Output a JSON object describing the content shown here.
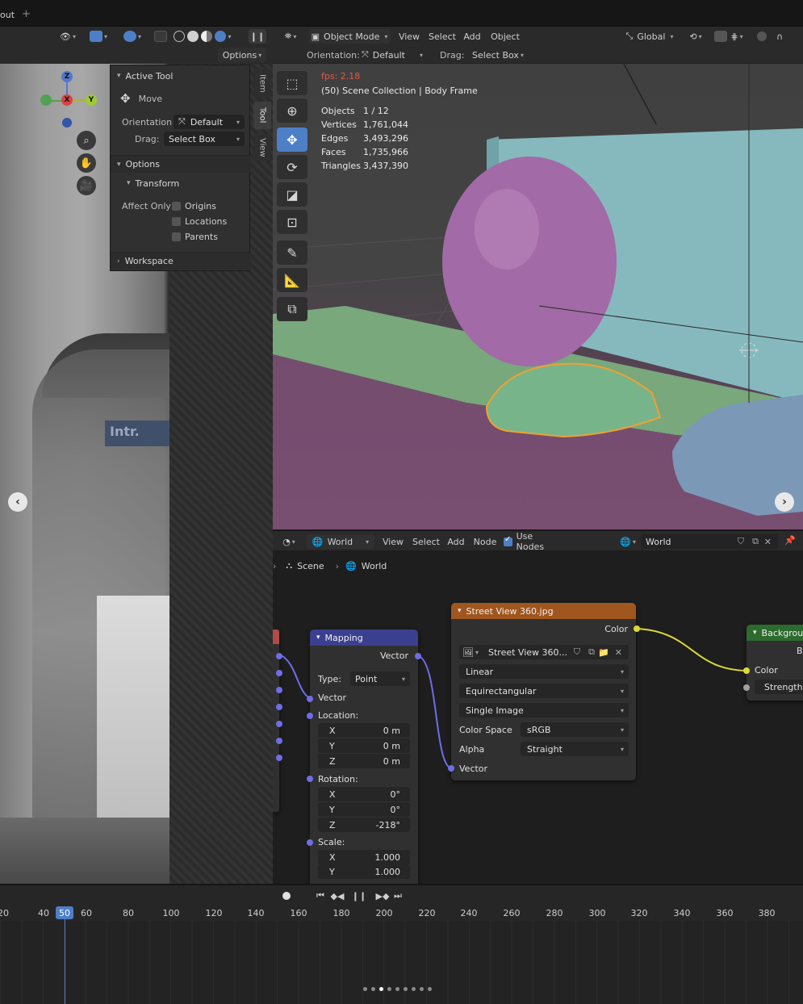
{
  "top": {
    "tab_label": "out",
    "plus": "+"
  },
  "left_viewport": {
    "options_label": "Options",
    "gizmo": {
      "z": "Z",
      "x": "X",
      "y": "Y"
    }
  },
  "tool_panel": {
    "active_tool": "Active Tool",
    "move": "Move",
    "orientation_label": "Orientation",
    "orientation_value": "Default",
    "drag_label": "Drag:",
    "drag_value": "Select Box",
    "options": "Options",
    "transform": "Transform",
    "affect_only": "Affect Only",
    "origins": "Origins",
    "locations": "Locations",
    "parents": "Parents",
    "workspace": "Workspace"
  },
  "side_tabs": [
    "Item",
    "Tool",
    "View"
  ],
  "viewport_header": {
    "mode": "Object Mode",
    "menus": [
      "View",
      "Select",
      "Add",
      "Object"
    ],
    "transform_orientation": "Global",
    "orientation_label": "Orientation:",
    "orientation_value": "Default",
    "drag_label": "Drag:",
    "drag_value": "Select Box"
  },
  "overlay": {
    "fps": "fps: 2.18",
    "collection": "(50) Scene Collection | Body Frame",
    "stats": [
      {
        "k": "Objects",
        "v": "1 / 12"
      },
      {
        "k": "Vertices",
        "v": "1,761,044"
      },
      {
        "k": "Edges",
        "v": "3,493,296"
      },
      {
        "k": "Faces",
        "v": "1,735,966"
      },
      {
        "k": "Triangles",
        "v": "3,437,390"
      }
    ]
  },
  "node_editor": {
    "world_dropdown": "World",
    "menus": [
      "View",
      "Select",
      "Add",
      "Node"
    ],
    "use_nodes": "Use Nodes",
    "world_field": "World",
    "breadcrumb": {
      "scene": "Scene",
      "world": "World"
    },
    "mapping": {
      "title": "Mapping",
      "vector_out": "Vector",
      "type_label": "Type:",
      "type_value": "Point",
      "vector_in": "Vector",
      "location": "Location:",
      "loc": [
        {
          "a": "X",
          "v": "0 m"
        },
        {
          "a": "Y",
          "v": "0 m"
        },
        {
          "a": "Z",
          "v": "0 m"
        }
      ],
      "rotation": "Rotation:",
      "rot": [
        {
          "a": "X",
          "v": "0°"
        },
        {
          "a": "Y",
          "v": "0°"
        },
        {
          "a": "Z",
          "v": "-218°"
        }
      ],
      "scale": "Scale:",
      "scl": [
        {
          "a": "X",
          "v": "1.000"
        },
        {
          "a": "Y",
          "v": "1.000"
        }
      ]
    },
    "image_texture": {
      "title": "Street View 360.jpg",
      "color_out": "Color",
      "image_name": "Street View 360...",
      "interpolation": "Linear",
      "projection": "Equirectangular",
      "source": "Single Image",
      "color_space_label": "Color Space",
      "color_space_value": "sRGB",
      "alpha_label": "Alpha",
      "alpha_value": "Straight",
      "vector_in": "Vector"
    },
    "background": {
      "title": "Backgrou",
      "out": "B",
      "color_in": "Color",
      "strength": "Strength"
    }
  },
  "timeline": {
    "current_frame": "50",
    "ticks": [
      "20",
      "40",
      "60",
      "80",
      "100",
      "120",
      "140",
      "160",
      "180",
      "200",
      "220",
      "240",
      "260",
      "280",
      "300",
      "320",
      "340",
      "360",
      "380"
    ]
  },
  "carousel": {
    "dot_count": 9,
    "active_index": 2
  },
  "colors": {
    "accent_blue": "#4d7fc7",
    "image_node_header": "#a0561f",
    "mapping_node_header": "#3b3f8f",
    "background_node_header": "#2d6a2d",
    "balloon": "#a26aa6",
    "car_selected": "#78b48a",
    "wall": "#86b9bd"
  }
}
